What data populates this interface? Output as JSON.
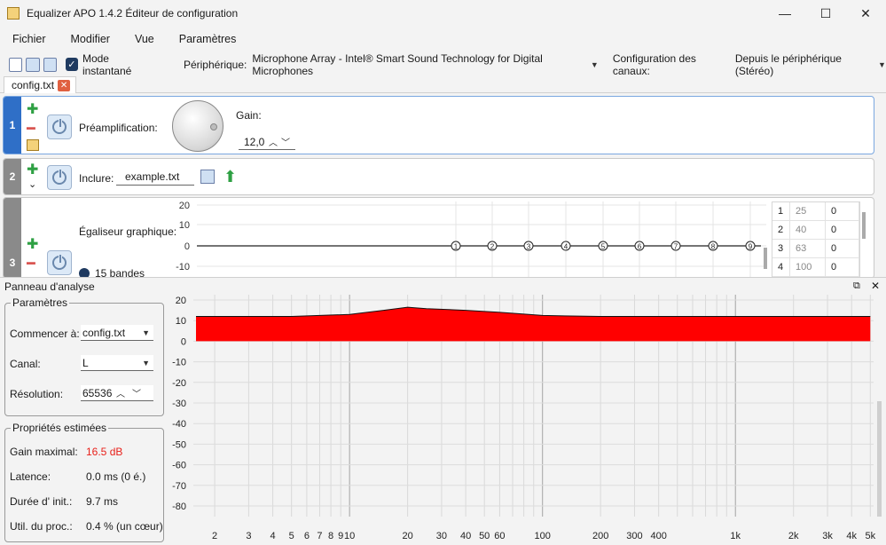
{
  "window": {
    "title": "Equalizer APO 1.4.2 Éditeur de configuration"
  },
  "menu": [
    "Fichier",
    "Modifier",
    "Vue",
    "Paramètres"
  ],
  "toolbar": {
    "instant_mode": "Mode instantané",
    "device_label": "Périphérique:",
    "device_value": "Microphone Array - Intel® Smart Sound Technology for Digital Microphones",
    "channel_label": "Configuration des canaux:",
    "channel_value": "Depuis le périphérique (Stéréo)"
  },
  "tab": {
    "label": "config.txt"
  },
  "filters": [
    {
      "num": "1",
      "type": "Préamplification:",
      "gain_label": "Gain:",
      "gain_value": "12,0"
    },
    {
      "num": "2",
      "type": "Inclure:",
      "file": "example.txt"
    },
    {
      "num": "3",
      "type": "Égaliseur graphique:",
      "bands_label": "15 bandes",
      "yticks": [
        "20",
        "10",
        "0",
        "-10"
      ],
      "nodes": [
        "1",
        "2",
        "3",
        "4",
        "5",
        "6",
        "7",
        "8",
        "9"
      ],
      "table": [
        [
          "1",
          "25",
          "0"
        ],
        [
          "2",
          "40",
          "0"
        ],
        [
          "3",
          "63",
          "0"
        ],
        [
          "4",
          "100",
          "0"
        ]
      ]
    }
  ],
  "analysis": {
    "title": "Panneau d'analyse",
    "params_title": "Paramètres",
    "start_label": "Commencer à:",
    "start_value": "config.txt",
    "channel_label": "Canal:",
    "channel_value": "L",
    "resolution_label": "Résolution:",
    "resolution_value": "65536",
    "props_title": "Propriétés estimées",
    "props": [
      {
        "label": "Gain maximal:",
        "value": "16.5 dB",
        "color": "#e8201a"
      },
      {
        "label": "Latence:",
        "value": "0.0 ms (0 é.)"
      },
      {
        "label": "Durée d' init.:",
        "value": "9.7 ms"
      },
      {
        "label": "Util. du proc.:",
        "value": "0.4 % (un cœur)"
      }
    ]
  },
  "chart_data": {
    "type": "area",
    "yticks": [
      "20",
      "10",
      "0",
      "-10",
      "-20",
      "-30",
      "-40",
      "-50",
      "-60",
      "-70",
      "-80"
    ],
    "ylim": [
      -85,
      22
    ],
    "xlabels": [
      "2",
      "3",
      "4",
      "5",
      "6",
      "7",
      "8",
      "9",
      "10",
      "20",
      "30",
      "40",
      "50",
      "60",
      "100",
      "200",
      "300",
      "400",
      "1k",
      "2k",
      "3k",
      "4k",
      "5k"
    ],
    "x_hz": [
      2,
      3,
      4,
      5,
      6,
      7,
      8,
      9,
      10,
      20,
      30,
      40,
      50,
      60,
      100,
      200,
      300,
      400,
      1000,
      2000,
      3000,
      4000,
      5000
    ],
    "curve": [
      [
        1.6,
        12
      ],
      [
        5,
        12
      ],
      [
        10,
        13
      ],
      [
        15,
        15
      ],
      [
        20,
        16.5
      ],
      [
        25,
        15.8
      ],
      [
        40,
        15
      ],
      [
        60,
        14
      ],
      [
        100,
        12.5
      ],
      [
        200,
        12
      ],
      [
        400,
        12
      ],
      [
        1000,
        12
      ],
      [
        5000,
        12
      ]
    ],
    "fill_color": "#ff0000"
  }
}
